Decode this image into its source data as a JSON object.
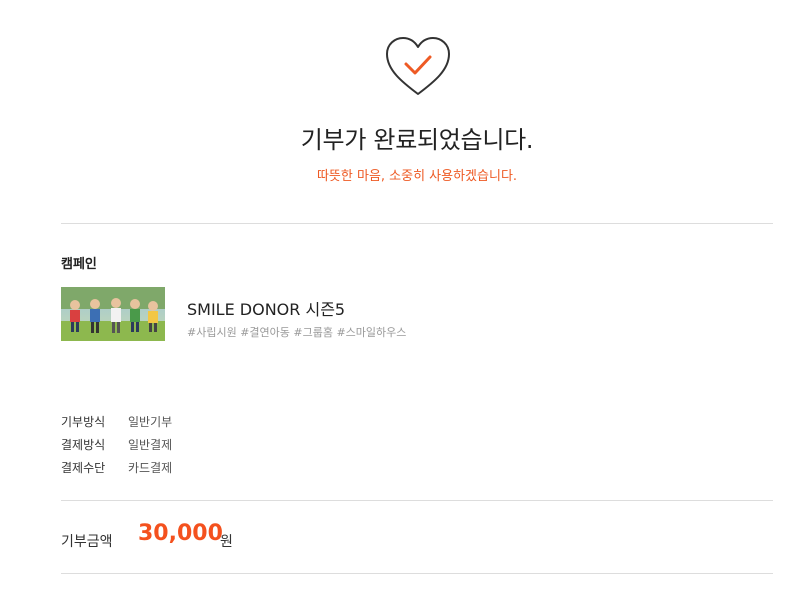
{
  "icons": {
    "complete": "heart-check-icon"
  },
  "colors": {
    "accent": "#ee5a24",
    "amount": "#f4511e",
    "divider": "#dddddd"
  },
  "header": {
    "title": "기부가 완료되었습니다.",
    "subtitle": "따뜻한 마음, 소중히 사용하겠습니다."
  },
  "campaign": {
    "section_label": "캠페인",
    "name": "SMILE DONOR 시즌5",
    "tags": "#사립시원 #결연아동 #그룹홈 #스마일하우스"
  },
  "details": [
    {
      "label": "기부방식",
      "value": "일반기부"
    },
    {
      "label": "결제방식",
      "value": "일반결제"
    },
    {
      "label": "결제수단",
      "value": "카드결제"
    }
  ],
  "amount": {
    "label": "기부금액",
    "value": "30,000",
    "unit": "원"
  }
}
